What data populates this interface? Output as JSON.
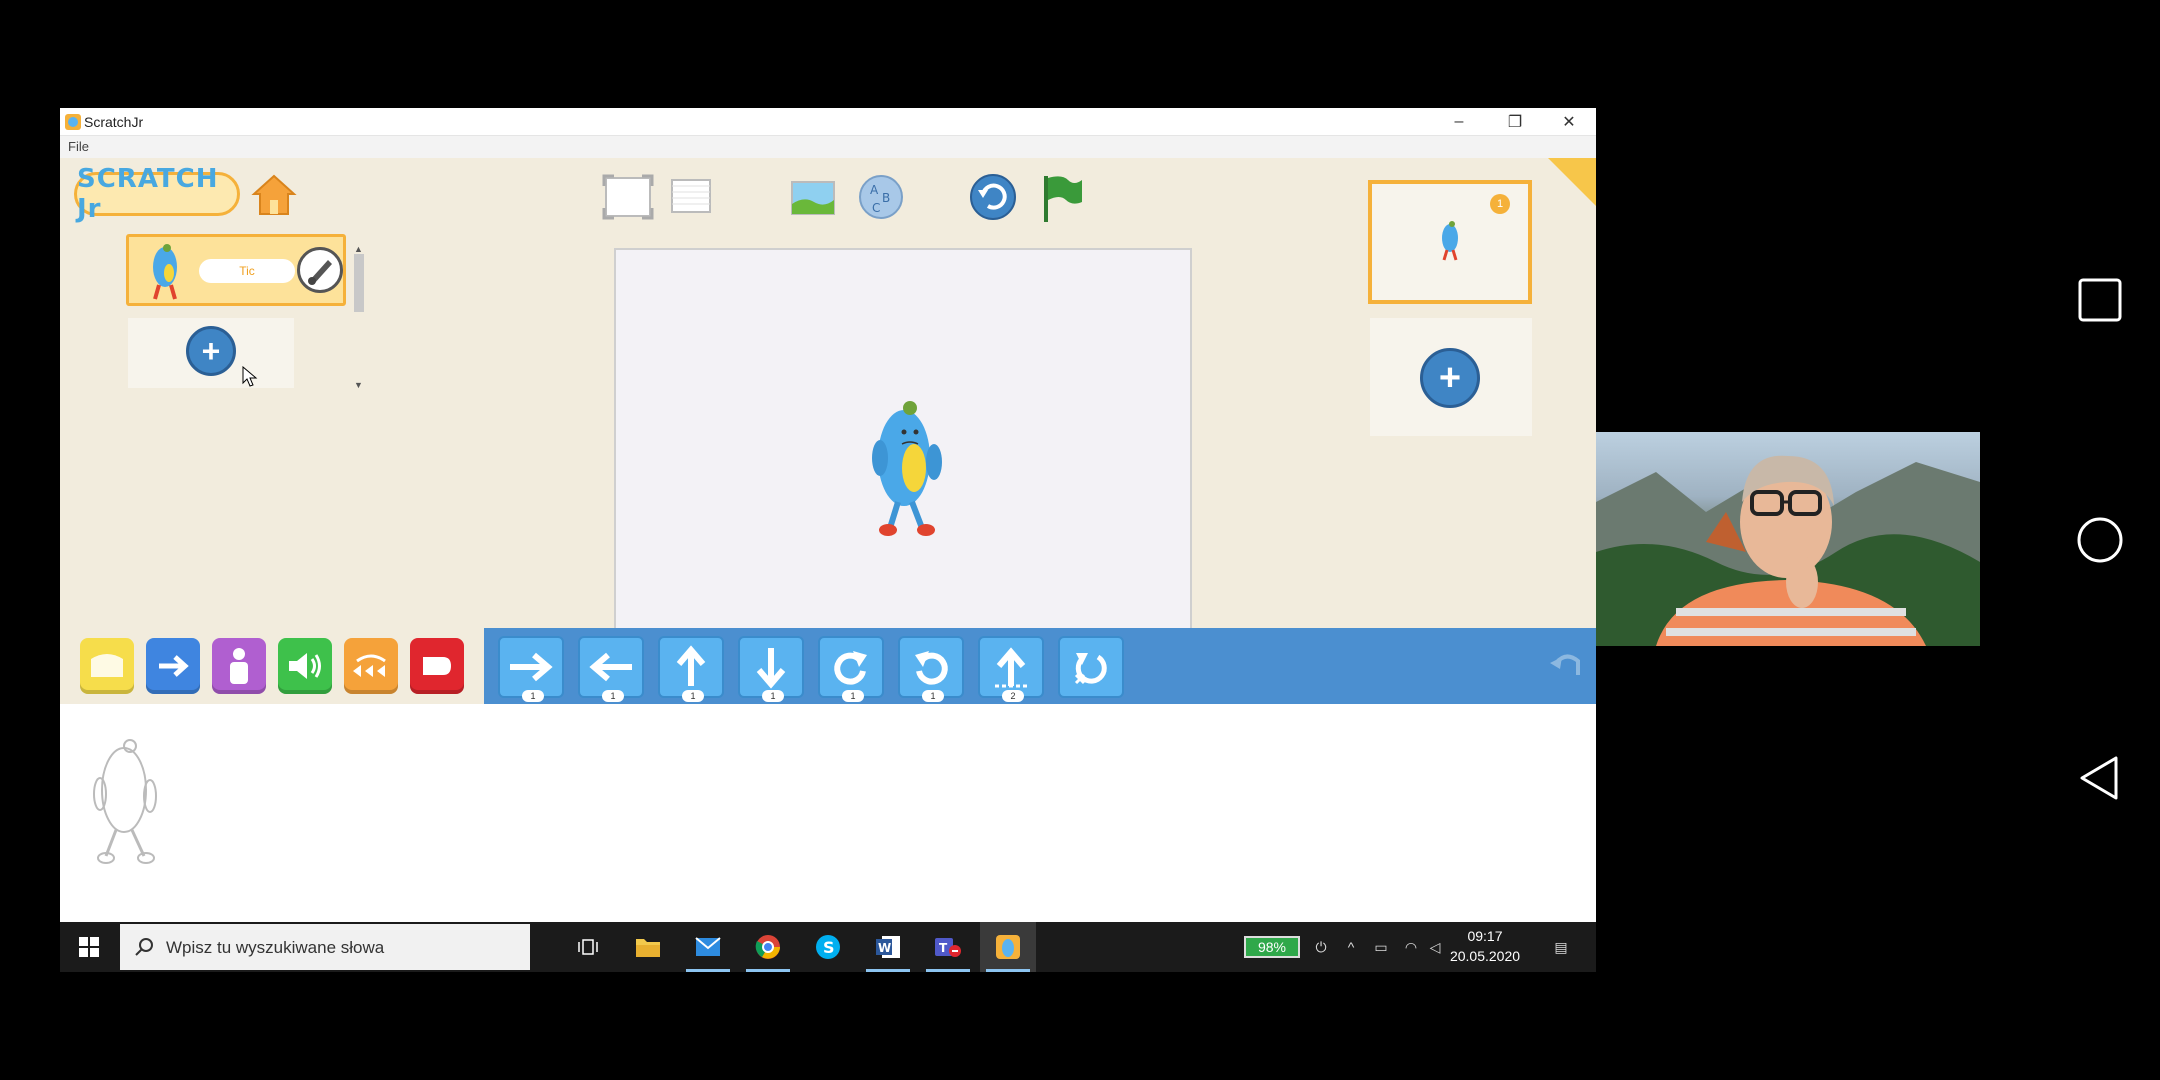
{
  "window": {
    "title": "ScratchJr",
    "controls": {
      "minimize": "–",
      "restore": "❐",
      "close": "✕"
    }
  },
  "menu": {
    "file": "File"
  },
  "scratchjr": {
    "logo": "SCRATCH Jr",
    "sprite_name": "Tic",
    "page_number": "1"
  },
  "taskbar": {
    "search_placeholder": "Wpisz tu wyszukiwane słowa",
    "battery": "98%",
    "time": "09:17",
    "date": "20.05.2020"
  },
  "blocks": [
    {
      "name": "move-right",
      "count": "1"
    },
    {
      "name": "move-left",
      "count": "1"
    },
    {
      "name": "move-up",
      "count": "1"
    },
    {
      "name": "move-down",
      "count": "1"
    },
    {
      "name": "turn-right",
      "count": "1"
    },
    {
      "name": "turn-left",
      "count": "1"
    },
    {
      "name": "hop",
      "count": "2"
    },
    {
      "name": "go-home",
      "count": ""
    }
  ],
  "colors": {
    "trigger": "#f6dd4b",
    "motion": "#3f85e0",
    "looks": "#b05fd0",
    "sound": "#3ec14b",
    "control": "#f5a23a",
    "end": "#e0262e",
    "motion_block": "#5ab3f0"
  }
}
